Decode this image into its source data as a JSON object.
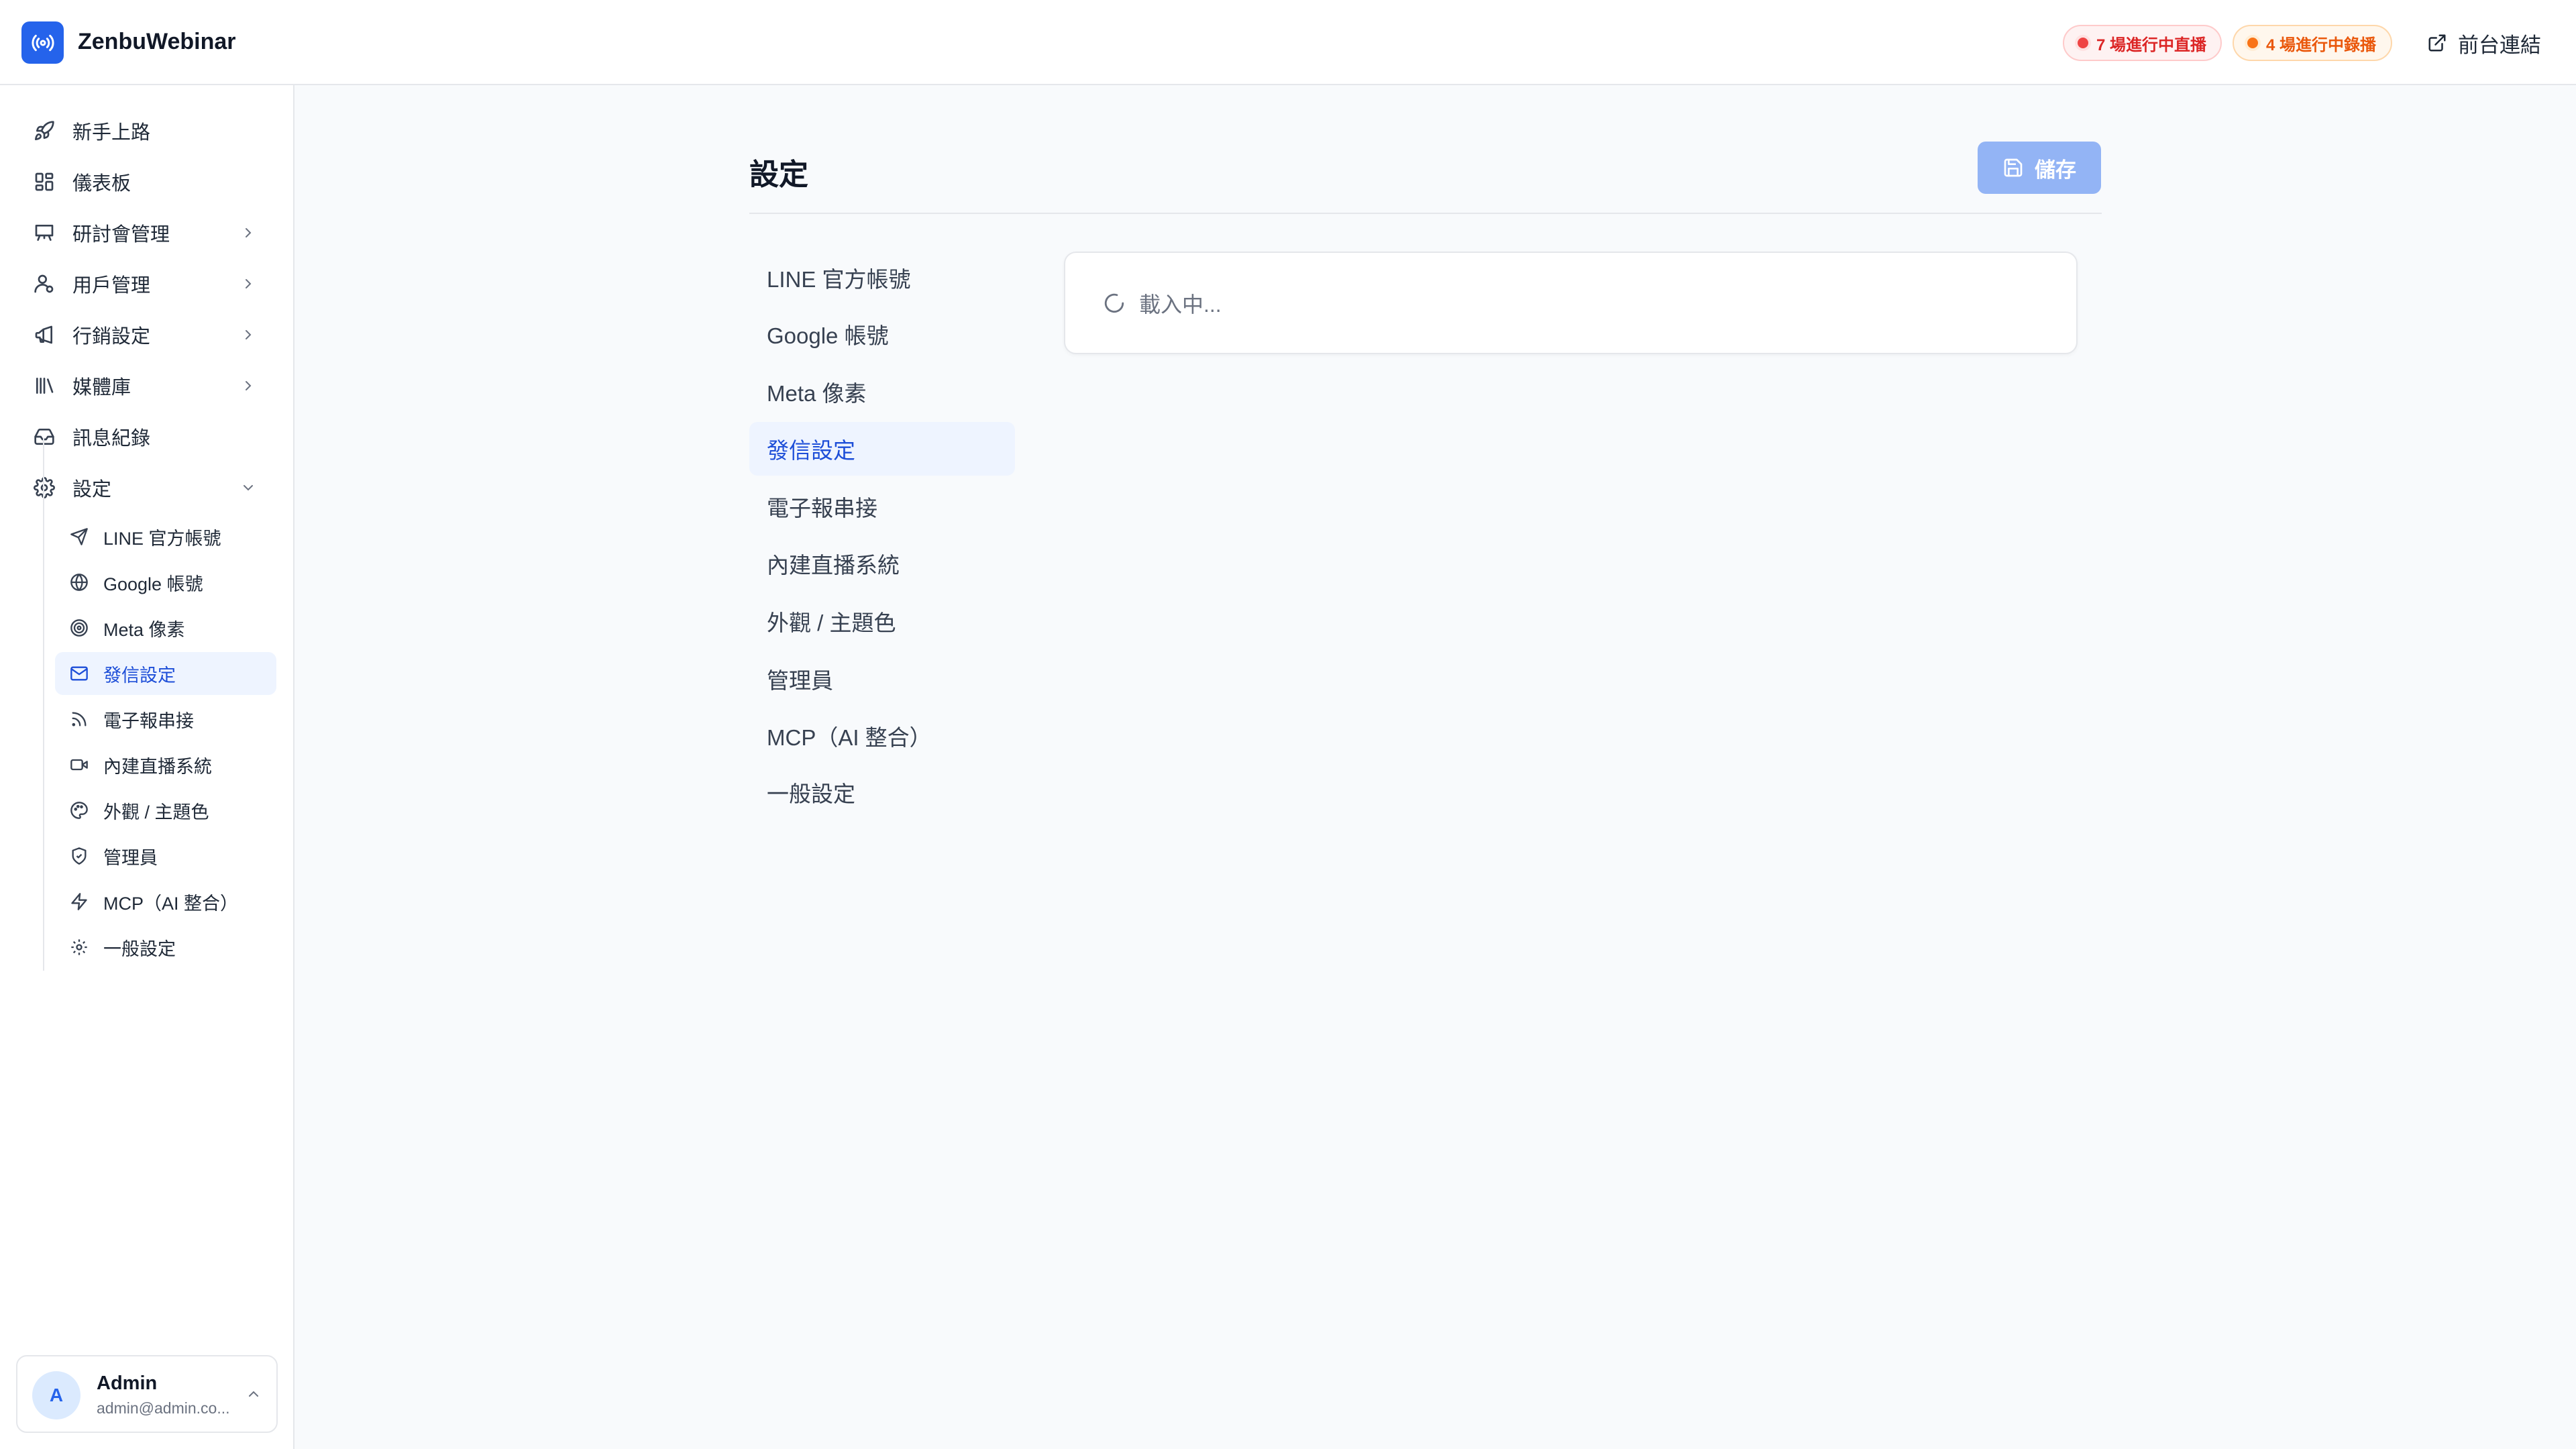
{
  "app": {
    "title": "ZenbuWebinar",
    "logo_icon": "broadcast-icon"
  },
  "header": {
    "badge_live": "7 場進行中直播",
    "badge_recording": "4 場進行中錄播",
    "front_link": "前台連結"
  },
  "sidebar": {
    "items": [
      {
        "label": "新手上路",
        "icon": "rocket-icon"
      },
      {
        "label": "儀表板",
        "icon": "dashboard-icon"
      },
      {
        "label": "研討會管理",
        "icon": "presentation-icon"
      },
      {
        "label": "用戶管理",
        "icon": "user-icon"
      },
      {
        "label": "行銷設定",
        "icon": "megaphone-icon"
      },
      {
        "label": "媒體庫",
        "icon": "library-icon"
      },
      {
        "label": "訊息紀錄",
        "icon": "inbox-icon"
      },
      {
        "label": "設定",
        "icon": "gear-icon"
      }
    ],
    "settings_sub": [
      {
        "label": "LINE 官方帳號",
        "icon": "send-icon"
      },
      {
        "label": "Google 帳號",
        "icon": "globe-icon"
      },
      {
        "label": "Meta 像素",
        "icon": "target-icon"
      },
      {
        "label": "發信設定",
        "icon": "mail-icon"
      },
      {
        "label": "電子報串接",
        "icon": "rss-icon"
      },
      {
        "label": "內建直播系統",
        "icon": "video-icon"
      },
      {
        "label": "外觀 / 主題色",
        "icon": "palette-icon"
      },
      {
        "label": "管理員",
        "icon": "shield-icon"
      },
      {
        "label": "MCP（AI 整合）",
        "icon": "bolt-icon"
      },
      {
        "label": "一般設定",
        "icon": "gear-icon"
      }
    ],
    "active_sub": "發信設定"
  },
  "user": {
    "initial": "A",
    "name": "Admin",
    "email": "admin@admin.co..."
  },
  "main": {
    "title": "設定",
    "save_label": "儲存",
    "sections": [
      "LINE 官方帳號",
      "Google 帳號",
      "Meta 像素",
      "發信設定",
      "電子報串接",
      "內建直播系統",
      "外觀 / 主題色",
      "管理員",
      "MCP（AI 整合）",
      "一般設定"
    ],
    "active_section": "發信設定",
    "loading_text": "載入中..."
  },
  "colors": {
    "accent": "#2563eb",
    "active_bg": "#eef4ff",
    "live_red": "#dc2626",
    "recording_orange": "#ea580c",
    "save_disabled": "#93b4f5"
  }
}
